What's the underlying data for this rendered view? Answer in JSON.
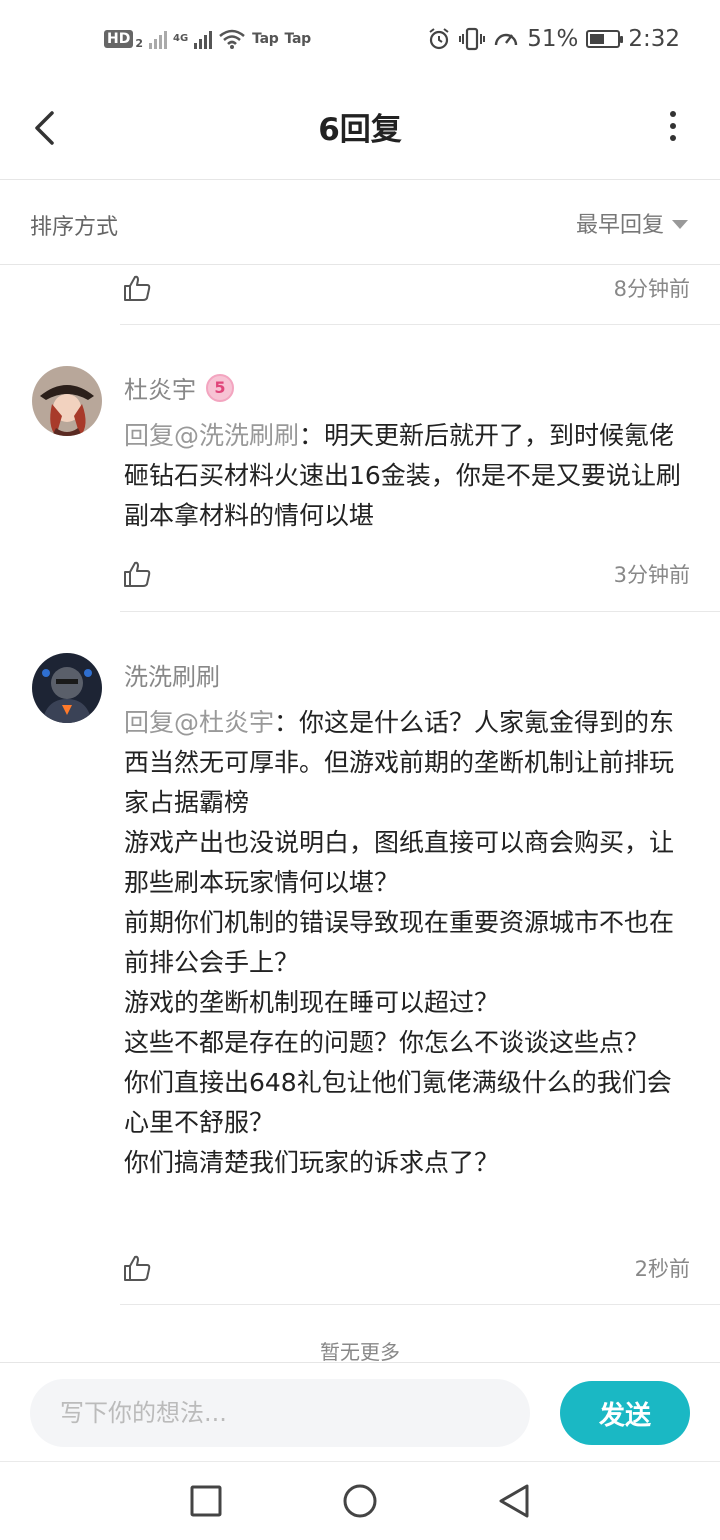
{
  "status_bar": {
    "hd_label": "HD",
    "hd_sub": "2",
    "network_4g": "4G",
    "tap_label_1": "Tap",
    "tap_label_2": "Tap",
    "battery_percent": "51%",
    "battery_level": 0.51,
    "time": "2:32"
  },
  "header": {
    "title": "6回复"
  },
  "sort": {
    "label": "排序方式",
    "selected": "最早回复"
  },
  "replies": [
    {
      "time": "8分钟前"
    },
    {
      "username": "杜炎宇",
      "level": "5",
      "mention": "回复@洗洗刷刷",
      "text": "：明天更新后就开了，到时候氪佬砸钻石买材料火速出16金装，你是不是又要说让刷副本拿材料的情何以堪",
      "time": "3分钟前"
    },
    {
      "username": "洗洗刷刷",
      "mention": "回复@杜炎宇",
      "text": "：你这是什么话？人家氪金得到的东西当然无可厚非。但游戏前期的垄断机制让前排玩家占据霸榜\n游戏产出也没说明白，图纸直接可以商会购买，让那些刷本玩家情何以堪？\n前期你们机制的错误导致现在重要资源城市不也在前排公会手上？\n游戏的垄断机制现在睡可以超过？\n这些不都是存在的问题？你怎么不谈谈这些点？\n你们直接出648礼包让他们氪佬满级什么的我们会心里不舒服？\n你们搞清楚我们玩家的诉求点了？",
      "time": "2秒前"
    }
  ],
  "footer_note": "暂无更多",
  "input": {
    "placeholder": "写下你的想法...",
    "value": "",
    "send_label": "发送"
  },
  "colors": {
    "accent": "#1ab8c4",
    "badge_pink": "#e0457a"
  }
}
